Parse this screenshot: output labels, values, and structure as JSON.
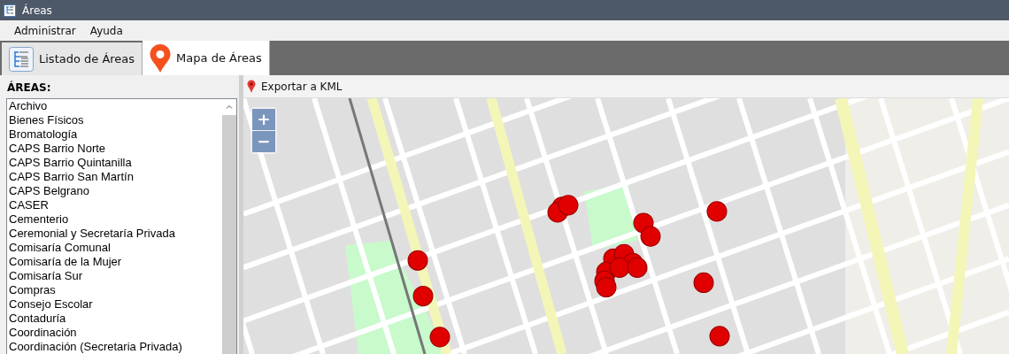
{
  "window": {
    "title": "Áreas"
  },
  "menu": [
    "Administrar",
    "Ayuda"
  ],
  "tabs": [
    {
      "label": "Listado de Áreas",
      "kind": "list",
      "selected": false
    },
    {
      "label": "Mapa de Áreas",
      "kind": "pin",
      "selected": true
    }
  ],
  "areas_panel": {
    "heading": "ÁREAS:",
    "items": [
      "Archivo",
      "Bienes Físicos",
      "Bromatología",
      "CAPS Barrio Norte",
      "CAPS Barrio Quintanilla",
      "CAPS Barrio San Martín",
      "CAPS Belgrano",
      "CASER",
      "Cementerio",
      "Ceremonial y Secretaría Privada",
      "Comisaría Comunal",
      "Comisaría de la Mujer",
      "Comisaría Sur",
      "Compras",
      "Consejo Escolar",
      "Contaduría",
      "Coordinación",
      "Coordinación (Secretaria Privada)"
    ]
  },
  "map_toolbar": {
    "export_button": "Exportar a KML"
  },
  "map": {
    "zoom_in": "+",
    "zoom_out": "−"
  }
}
